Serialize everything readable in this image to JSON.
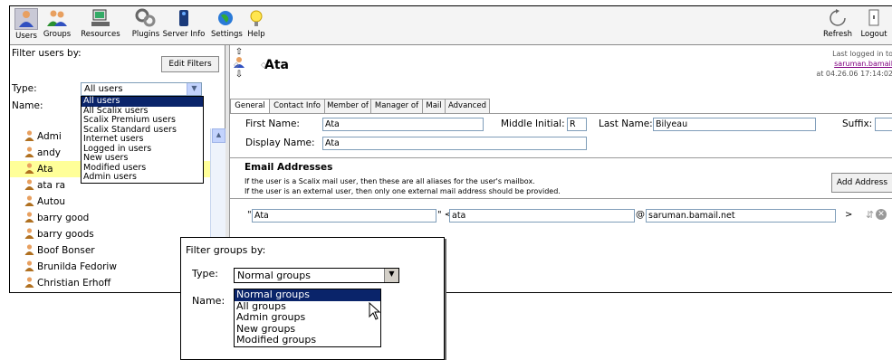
{
  "toolbar": {
    "left_items": [
      {
        "label": "Users",
        "icon": "users-icon",
        "selected": true
      },
      {
        "label": "Groups",
        "icon": "groups-icon"
      },
      {
        "label": "Resources",
        "icon": "resources-icon"
      },
      {
        "label": "Plugins",
        "icon": "plugins-icon"
      },
      {
        "label": "Server Info",
        "icon": "server-info-icon"
      },
      {
        "label": "Settings",
        "icon": "settings-icon"
      },
      {
        "label": "Help",
        "icon": "help-icon"
      }
    ],
    "refresh_label": "Refresh",
    "logout_label": "Logout"
  },
  "filter": {
    "title": "Filter users by:",
    "edit_filters_label": "Edit Filters",
    "type_label": "Type:",
    "type_value": "All users",
    "name_label": "Name:",
    "type_options": [
      "All users",
      "All Scalix users",
      "Scalix Premium users",
      "Scalix Standard users",
      "Internet users",
      "Logged in users",
      "New users",
      "Modified users",
      "Admin users"
    ]
  },
  "users": [
    "Admi",
    "andy",
    "Ata",
    "ata ra",
    "Autou",
    "barry good",
    "barry goods",
    "Boof Bonser",
    "Brunilda Fedoriw",
    "Christian Erhoff"
  ],
  "selected_user": "Ata",
  "header": {
    "name": "Ata",
    "last_logged": "Last logged in to",
    "server": "saruman.bamail",
    "timestamp": "at 04.26.06 17:14:02"
  },
  "tabs": [
    "General",
    "Contact Info",
    "Member of",
    "Manager of",
    "Mail",
    "Advanced"
  ],
  "general": {
    "first_name_label": "First Name:",
    "first_name": "Ata",
    "middle_initial_label": "Middle Initial:",
    "middle_initial": "R",
    "last_name_label": "Last Name:",
    "last_name": "Bilyeau",
    "suffix_label": "Suffix:",
    "suffix": "",
    "display_name_label": "Display Name:",
    "display_name": "Ata"
  },
  "email": {
    "title": "Email Addresses",
    "note1": "If the user is a Scalix mail user, then these are all aliases for the user's mailbox.",
    "note2": "If the user is an external user, then only one external mail address should be provided.",
    "add_address_label": "Add Address",
    "quote_open": "\"",
    "display": "Ata",
    "quote_lt": "\" <",
    "local": "ata",
    "at": "@",
    "domain": "saruman.bamail.net",
    "gt": ">"
  },
  "groups_filter": {
    "title": "Filter groups by:",
    "type_label": "Type:",
    "type_value": "Normal groups",
    "name_label": "Name:",
    "options": [
      "Normal groups",
      "All groups",
      "Admin groups",
      "New groups",
      "Modified groups"
    ]
  },
  "colors": {
    "selection": "#0a246a",
    "highlight_row": "#ffff99",
    "link": "#800080"
  }
}
